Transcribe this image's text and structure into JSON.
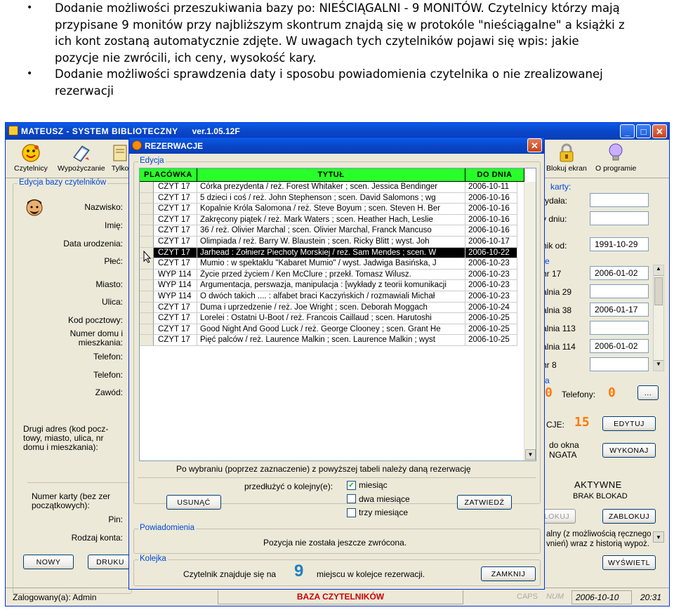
{
  "doc": {
    "bullet_symbol": "•",
    "bullets": [
      {
        "lines": [
          "Dodanie możliwości przeszukiwania bazy po: NIEŚCIĄGALNI - 9 MONITÓW. Czytelnicy którzy mają",
          "przypisane 9 monitów przy najbliższym skontrum znajdą się w protokóle \"nieściągalne\" a książki z",
          "ich kont zostaną automatycznie zdjęte. W uwagach tych czytelników pojawi się wpis: jakie",
          "pozycje nie zwrócili, ich ceny, wysokość kary."
        ]
      },
      {
        "lines": [
          "Dodanie możliwości sprawdzenia daty i sposobu powiadomienia czytelnika o nie zrealizowanej",
          "rezerwacji"
        ]
      }
    ]
  },
  "main_window": {
    "title": "MATEUSZ - SYSTEM BIBLIOTECZNY",
    "version": "ver.1.05.12F",
    "minimize_symbol": "_",
    "maximize_symbol": "□",
    "close_symbol": "✕",
    "toolbar": [
      {
        "label": "Czytelnicy",
        "icon": "smiley-icon"
      },
      {
        "label": "Wypożyczanie",
        "icon": "book-icon"
      },
      {
        "label": "Tylko",
        "icon": "document-icon"
      },
      {
        "label": "Blokuj ekran",
        "icon": "lock-icon"
      },
      {
        "label": "O programie",
        "icon": "lightbulb-icon"
      }
    ],
    "left_panel": {
      "legend": "Edycja bazy czytelników",
      "fields": [
        "Nazwisko:",
        "Imię:",
        "Data urodzenia:",
        "Płeć:",
        "Miasto:",
        "Ulica:",
        "Kod pocztowy:",
        "Numer domu i mieszkania:",
        "Telefon:",
        "Telefon:",
        "Zawód:"
      ],
      "address2_label": "Drugi adres (kod pocz-towy, miasto, ulica, nr domu i mieszkania):",
      "card_label": "Numer karty (bez zer początkowych):",
      "pin_label": "Pin:",
      "account_label": "Rodzaj konta:",
      "new_button": "NOWY",
      "print_button": "DRUKU"
    },
    "right_panel": {
      "legend_frag": "karty:",
      "l1": "rydała:",
      "l2": "v dniu:",
      "l3": "nik od:",
      "v3": "1991-10-29",
      "l4": "e",
      "rows": [
        {
          "label": "hr 17",
          "value": "2006-01-02"
        },
        {
          "label": "alnia 29",
          "value": ""
        },
        {
          "label": "alnia 38",
          "value": "2006-01-17"
        },
        {
          "label": "alnia 113",
          "value": ""
        },
        {
          "label": "alnia 114",
          "value": "2006-01-02"
        },
        {
          "label": "hr 8",
          "value": ""
        }
      ],
      "a_frag": "a",
      "digit_left": "0",
      "phones_label": "Telefony:",
      "phones_digit": "0",
      "dots_button": "...",
      "cje_label": "CJE:",
      "cje_digit": "15",
      "edit_button": "EDYTUJ",
      "window_label_1": "do okna",
      "window_label_2": "NGATA",
      "execute_button": "WYKONAJ",
      "status_active": "AKTYWNE",
      "status_block": "BRAK BLOKAD",
      "unblock_button": "LOKUJ",
      "block_button": "ZABLOKUJ",
      "history_text_1": "alny (z możliwością ręcznego",
      "history_text_2": "vnień) wraz z historią wypoż.",
      "show_button": "WYŚWIETL"
    },
    "status": {
      "logged": "Zalogowany(a): Admin",
      "base": "BAZA CZYTELNIKÓW",
      "caps": "CAPS",
      "num": "NUM",
      "date": "2006-10-10",
      "time": "20:31"
    }
  },
  "dialog": {
    "title": "REZERWACJE",
    "close_symbol": "✕",
    "edit_legend": "Edycja",
    "columns": [
      "PLACÓWKA",
      "TYTUŁ",
      "DO DNIA"
    ],
    "rows": [
      {
        "branch": "CZYT 17",
        "title": "Córka prezydenta /    reż. Forest Whitaker ; scen. Jessica Bendinger",
        "date": "2006-10-11"
      },
      {
        "branch": "CZYT 17",
        "title": "5 dzieci i coś /    reż. John Stephenson ; scen. David Salomons ; wg",
        "date": "2006-10-16"
      },
      {
        "branch": "CZYT 17",
        "title": "Kopalnie Króla Salomona /    reż. Steve Boyum ; scen. Steven H. Ber",
        "date": "2006-10-16"
      },
      {
        "branch": "CZYT 17",
        "title": "Zakręcony piątek /    reż. Mark Waters ; scen. Heather Hach, Leslie",
        "date": "2006-10-16"
      },
      {
        "branch": "CZYT 17",
        "title": "36 /    reż. Olivier Marchal ; scen. Olivier Marchal, Franck Mancuso",
        "date": "2006-10-16"
      },
      {
        "branch": "CZYT 17",
        "title": "Olimpiada /    reż. Barry W. Blaustein ; scen. Ricky Blitt ; wyst. Joh",
        "date": "2006-10-17"
      },
      {
        "branch": "CZYT 17",
        "title": "Jarhead : Żołnierz Piechoty Morskiej /    reż. Sam Mendes ; scen. W",
        "date": "2006-10-22"
      },
      {
        "branch": "CZYT 17",
        "title": "Mumio : w spektaklu \"Kabaret Mumio\" /    wyst. Jadwiga Basińska, J",
        "date": "2006-10-23"
      },
      {
        "branch": "WYP 114",
        "title": "Życie przed życiem /    Ken McClure ; przekł. Tomasz Wilusz.",
        "date": "2006-10-23"
      },
      {
        "branch": "WYP 114",
        "title": "Argumentacja, perswazja, manipulacja : [wykłady z teorii komunikacji",
        "date": "2006-10-23"
      },
      {
        "branch": "WYP 114",
        "title": "O dwóch takich .... : alfabet braci Kaczyńskich /    rozmawiali Michał",
        "date": "2006-10-23"
      },
      {
        "branch": "CZYT 17",
        "title": "Duma i uprzedzenie /    reż. Joe Wright ; scen. Deborah Moggach",
        "date": "2006-10-24"
      },
      {
        "branch": "CZYT 17",
        "title": "Lorelei : Ostatni U-Boot /    reż. Francois Caillaud ; scen. Harutoshi",
        "date": "2006-10-25"
      },
      {
        "branch": "CZYT 17",
        "title": "Good Night And Good Luck /    reż. George Clooney ; scen. Grant He",
        "date": "2006-10-25"
      },
      {
        "branch": "CZYT 17",
        "title": "Pięć palców /    reż. Laurence Malkin ; scen. Laurence Malkin ; wyst",
        "date": "2006-10-25"
      }
    ],
    "selected_row_index": 6,
    "hint": "Po wybraniu (poprzez zaznaczenie) z powyższej tabeli należy daną rezerwację",
    "remove_button": "USUNĄĆ",
    "extend_label": "przedłużyć o kolejny(e):",
    "extend_options": [
      {
        "label": "miesiąc",
        "checked": true
      },
      {
        "label": "dwa miesiące",
        "checked": false
      },
      {
        "label": "trzy miesiące",
        "checked": false
      }
    ],
    "check_symbol": "✓",
    "confirm_button": "ZATWIEDŹ",
    "notify_legend": "Powiadomienia",
    "notify_text": "Pozycja nie została jeszcze zwrócona.",
    "queue_legend": "Kolejka",
    "queue_before": "Czytelnik znajduje się na",
    "queue_number": "9",
    "queue_after": "miejscu w kolejce rezerwacji.",
    "close_button": "ZAMKNIJ",
    "scroll_up": "▲",
    "scroll_down": "▼"
  }
}
